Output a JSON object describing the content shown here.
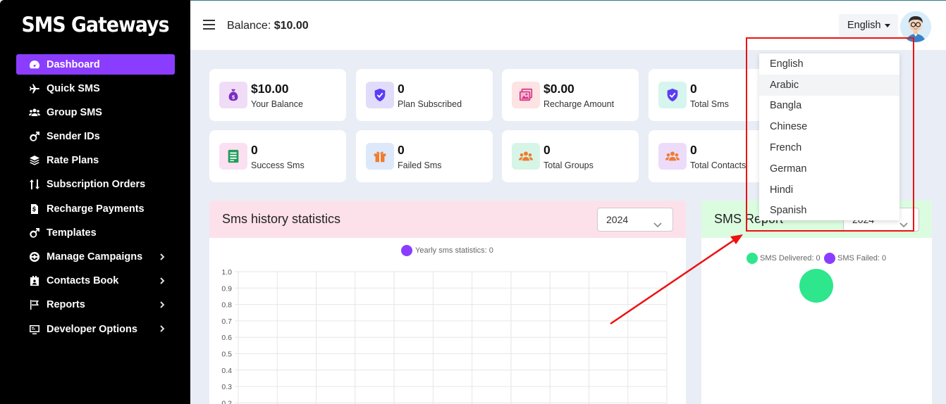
{
  "app": {
    "brand": "SMS Gateways"
  },
  "sidebar": {
    "items": [
      {
        "label": "Dashboard",
        "icon": "gauge-icon",
        "active": true,
        "has_submenu": false
      },
      {
        "label": "Quick SMS",
        "icon": "plane-icon",
        "active": false,
        "has_submenu": false
      },
      {
        "label": "Group SMS",
        "icon": "users-icon",
        "active": false,
        "has_submenu": false
      },
      {
        "label": "Sender IDs",
        "icon": "male-icon",
        "active": false,
        "has_submenu": false
      },
      {
        "label": "Rate Plans",
        "icon": "layers-icon",
        "active": false,
        "has_submenu": false
      },
      {
        "label": "Subscription Orders",
        "icon": "sort-icon",
        "active": false,
        "has_submenu": false
      },
      {
        "label": "Recharge Payments",
        "icon": "invoice-icon",
        "active": false,
        "has_submenu": false
      },
      {
        "label": "Templates",
        "icon": "male-icon",
        "active": false,
        "has_submenu": false
      },
      {
        "label": "Manage Campaigns",
        "icon": "campaign-icon",
        "active": false,
        "has_submenu": true
      },
      {
        "label": "Contacts Book",
        "icon": "contact-card-icon",
        "active": false,
        "has_submenu": true
      },
      {
        "label": "Reports",
        "icon": "flag-icon",
        "active": false,
        "has_submenu": true
      },
      {
        "label": "Developer Options",
        "icon": "monitor-icon",
        "active": false,
        "has_submenu": true
      }
    ]
  },
  "header": {
    "balance_label": "Balance:",
    "balance_value": "$10.00",
    "language": "English"
  },
  "stats": {
    "row1": [
      {
        "value": "$10.00",
        "label": "Your Balance",
        "icon": "money-bag-icon",
        "bg": "#f0dcf7",
        "fg": "#7a2fbf"
      },
      {
        "value": "0",
        "label": "Plan Subscribed",
        "icon": "shield-check-icon",
        "bg": "#e2dcfb",
        "fg": "#5b3df5"
      },
      {
        "value": "$0.00",
        "label": "Recharge Amount",
        "icon": "images-icon",
        "bg": "#fde3e3",
        "fg": "#d63384"
      },
      {
        "value": "0",
        "label": "Total Sms",
        "icon": "shield-check-icon",
        "bg": "#d6f5ee",
        "fg": "#5b3df5"
      }
    ],
    "row2": [
      {
        "value": "0",
        "label": "Success Sms",
        "icon": "sheet-icon",
        "bg": "#fbe0f1",
        "fg": "#1f9e5a"
      },
      {
        "value": "0",
        "label": "Failed Sms",
        "icon": "gift-icon",
        "bg": "#dde8fb",
        "fg": "#f07b2f"
      },
      {
        "value": "0",
        "label": "Total Groups",
        "icon": "group-icon",
        "bg": "#d6f5e6",
        "fg": "#f07b2f"
      },
      {
        "value": "0",
        "label": "Total Contacts",
        "icon": "group-icon",
        "bg": "#ecdcfa",
        "fg": "#f07b2f"
      }
    ]
  },
  "history_panel": {
    "title": "Sms history statistics",
    "year": "2024",
    "header_bg": "#fde1ea"
  },
  "report_panel": {
    "title": "SMS Report",
    "year": "2024",
    "header_bg": "#dcfce0"
  },
  "chart_data": [
    {
      "type": "line",
      "title": "",
      "legend": "top",
      "series": [
        {
          "name": "Yearly sms statistics: 0",
          "values": [],
          "color": "#8b3dff"
        }
      ],
      "yticks": [
        "1.0",
        "0.9",
        "0.8",
        "0.7",
        "0.6",
        "0.5",
        "0.4",
        "0.3",
        "0.2"
      ],
      "ylim": [
        0,
        1.0
      ],
      "grid": true
    },
    {
      "type": "pie",
      "title": "",
      "legend": "top",
      "series": [
        {
          "name": "SMS Delivered: 0",
          "value": 0,
          "color": "#2ee68c"
        },
        {
          "name": "SMS Failed: 0",
          "value": 0,
          "color": "#8b3dff"
        }
      ]
    }
  ],
  "language_dropdown": {
    "options": [
      "English",
      "Arabic",
      "Bangla",
      "Chinese",
      "French",
      "German",
      "Hindi",
      "Spanish"
    ],
    "hovered": "Arabic"
  },
  "colors": {
    "accent": "#8b3dff",
    "annotation": "#ee1111"
  }
}
